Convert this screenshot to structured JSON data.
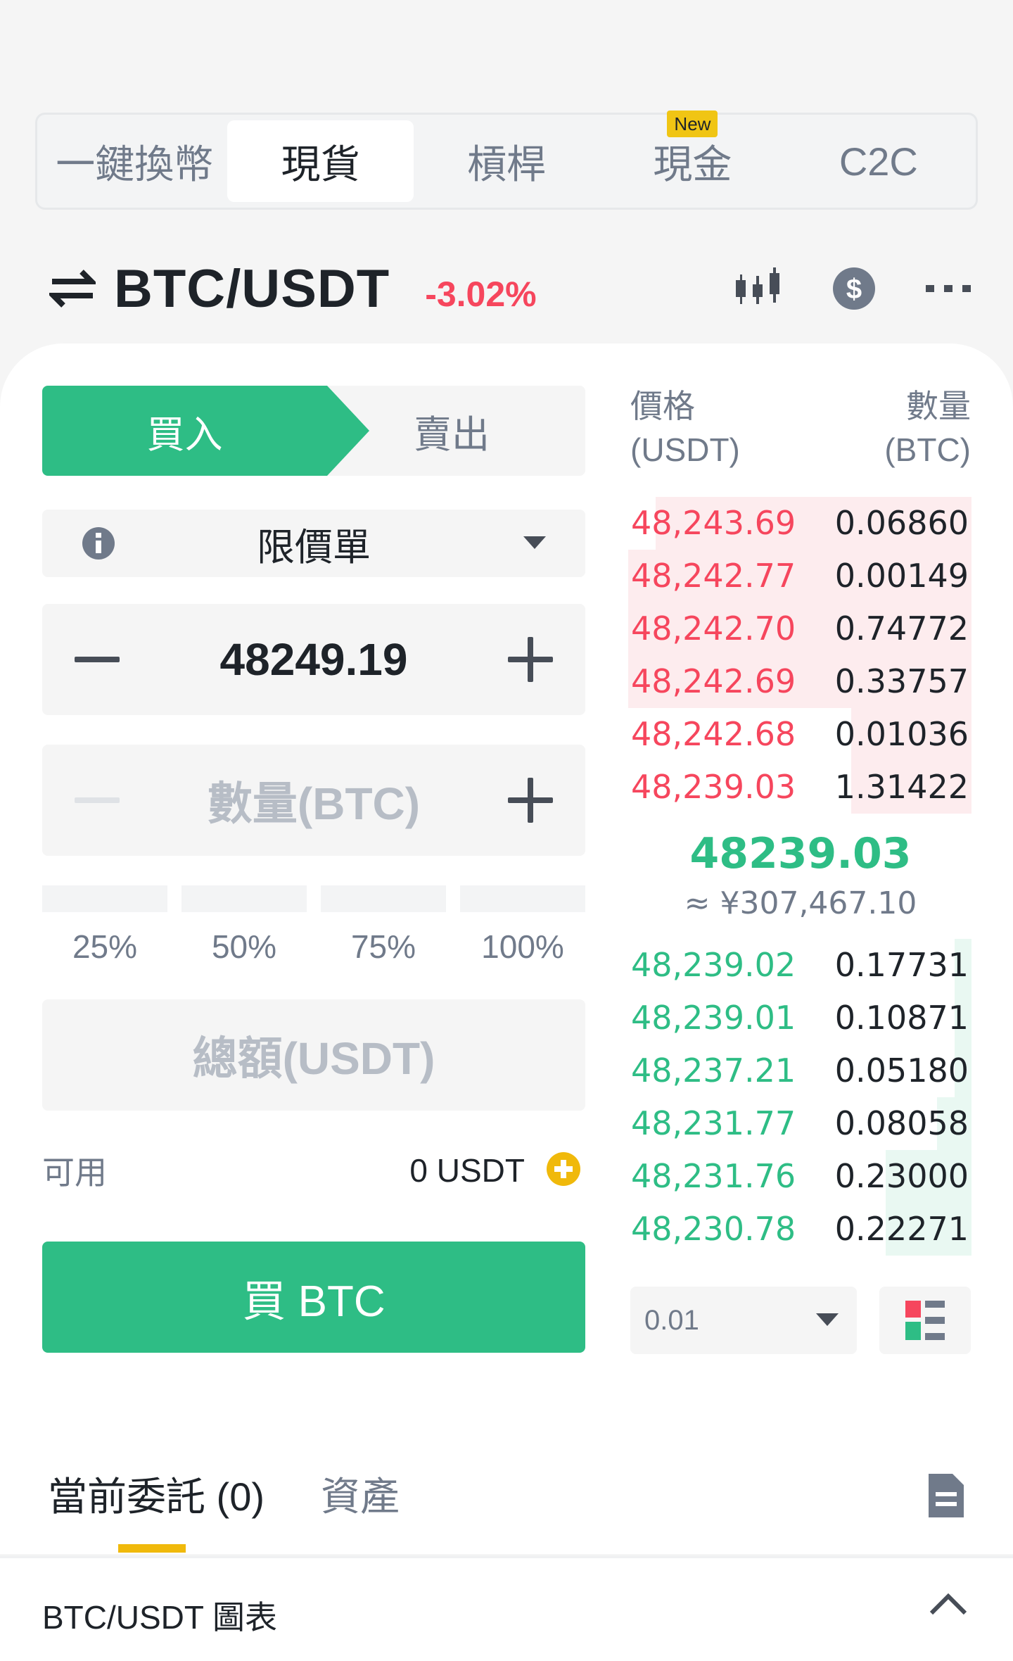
{
  "top_tabs": [
    {
      "label": "一鍵換幣",
      "active": false
    },
    {
      "label": "現貨",
      "active": true
    },
    {
      "label": "槓桿",
      "active": false
    },
    {
      "label": "現金",
      "active": false,
      "badge": "New"
    },
    {
      "label": "C2C",
      "active": false
    }
  ],
  "header": {
    "pair": "BTC/USDT",
    "change": "-3.02%",
    "icons": [
      "swap-icon",
      "candlestick-icon",
      "dollar-icon",
      "more-icon"
    ]
  },
  "form": {
    "buy_label": "買入",
    "sell_label": "賣出",
    "order_type": "限價單",
    "price_value": "48249.19",
    "amount_placeholder": "數量(BTC)",
    "percentages": [
      "25%",
      "50%",
      "75%",
      "100%"
    ],
    "total_placeholder": "總額(USDT)",
    "available_label": "可用",
    "available_value": "0 USDT",
    "buy_button": "買 BTC"
  },
  "orderbook": {
    "price_header": [
      "價格",
      "(USDT)"
    ],
    "qty_header": [
      "數量",
      "(BTC)"
    ],
    "asks": [
      {
        "price": "48,243.69",
        "qty": "0.06860",
        "depth": 0.92
      },
      {
        "price": "48,242.77",
        "qty": "0.00149",
        "depth": 1.0
      },
      {
        "price": "48,242.70",
        "qty": "0.74772",
        "depth": 1.0
      },
      {
        "price": "48,242.69",
        "qty": "0.33757",
        "depth": 1.0
      },
      {
        "price": "48,242.68",
        "qty": "0.01036",
        "depth": 0.35
      },
      {
        "price": "48,239.03",
        "qty": "1.31422",
        "depth": 0.35
      }
    ],
    "last_price": "48239.03",
    "fiat_price": "≈ ¥307,467.10",
    "bids": [
      {
        "price": "48,239.02",
        "qty": "0.17731",
        "depth": 0.05
      },
      {
        "price": "48,239.01",
        "qty": "0.10871",
        "depth": 0.05
      },
      {
        "price": "48,237.21",
        "qty": "0.05180",
        "depth": 0.05
      },
      {
        "price": "48,231.77",
        "qty": "0.08058",
        "depth": 0.1
      },
      {
        "price": "48,231.76",
        "qty": "0.23000",
        "depth": 0.25
      },
      {
        "price": "48,230.78",
        "qty": "0.22271",
        "depth": 0.25
      }
    ],
    "precision": "0.01"
  },
  "bottom": {
    "tabs": [
      "當前委託 (0)",
      "資產"
    ],
    "chart_label": "BTC/USDT 圖表"
  },
  "colors": {
    "buy": "#2ebd85",
    "sell": "#f6465d",
    "accent": "#f0b90b"
  }
}
